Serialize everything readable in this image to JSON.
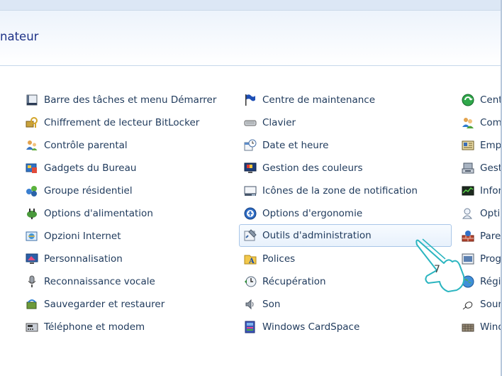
{
  "window": {
    "title": "nateur"
  },
  "columns": [
    {
      "items": [
        {
          "label": "Barre des tâches et menu Démarrer",
          "icon": "taskbar-icon"
        },
        {
          "label": "Chiffrement de lecteur BitLocker",
          "icon": "bitlocker-key-icon"
        },
        {
          "label": "Contrôle parental",
          "icon": "parental-control-icon"
        },
        {
          "label": "Gadgets du Bureau",
          "icon": "desktop-gadgets-icon"
        },
        {
          "label": "Groupe résidentiel",
          "icon": "homegroup-icon"
        },
        {
          "label": "Options d'alimentation",
          "icon": "power-options-icon"
        },
        {
          "label": "Opzioni Internet",
          "icon": "internet-options-icon"
        },
        {
          "label": "Personnalisation",
          "icon": "personalization-icon"
        },
        {
          "label": "Reconnaissance vocale",
          "icon": "microphone-icon"
        },
        {
          "label": "Sauvegarder et restaurer",
          "icon": "backup-restore-icon"
        },
        {
          "label": "Téléphone et modem",
          "icon": "phone-modem-icon"
        }
      ]
    },
    {
      "items": [
        {
          "label": "Centre de maintenance",
          "icon": "flag-icon"
        },
        {
          "label": "Clavier",
          "icon": "keyboard-icon"
        },
        {
          "label": "Date et heure",
          "icon": "date-time-icon"
        },
        {
          "label": "Gestion des couleurs",
          "icon": "color-management-icon"
        },
        {
          "label": "Icônes de la zone de notification",
          "icon": "notification-area-icon"
        },
        {
          "label": "Options d'ergonomie",
          "icon": "ease-of-access-icon"
        },
        {
          "label": "Outils d'administration",
          "icon": "admin-tools-icon"
        },
        {
          "label": "Polices",
          "icon": "fonts-icon"
        },
        {
          "label": "Récupération",
          "icon": "recovery-icon"
        },
        {
          "label": "Son",
          "icon": "speaker-icon"
        },
        {
          "label": "Windows CardSpace",
          "icon": "cardspace-icon"
        }
      ]
    },
    {
      "items": [
        {
          "label": "Cent",
          "icon": "sync-center-icon"
        },
        {
          "label": "Com",
          "icon": "users-icon"
        },
        {
          "label": "Emp",
          "icon": "credential-icon"
        },
        {
          "label": "Gest",
          "icon": "device-manager-icon"
        },
        {
          "label": "Infor",
          "icon": "performance-icon"
        },
        {
          "label": "Optic",
          "icon": "folder-options-icon"
        },
        {
          "label": "Pare",
          "icon": "firewall-icon"
        },
        {
          "label": "Prog",
          "icon": "programs-icon"
        },
        {
          "label": "Régi",
          "icon": "region-globe-icon"
        },
        {
          "label": "Sour",
          "icon": "mouse-icon"
        },
        {
          "label": "Wind",
          "icon": "windows-update-icon"
        }
      ]
    }
  ],
  "callout": {
    "number": "7"
  },
  "colors": {
    "accent": "#1e3287",
    "text": "#1e395b",
    "hover_border": "#a9c6e8",
    "callout": "#2bb5c0"
  }
}
